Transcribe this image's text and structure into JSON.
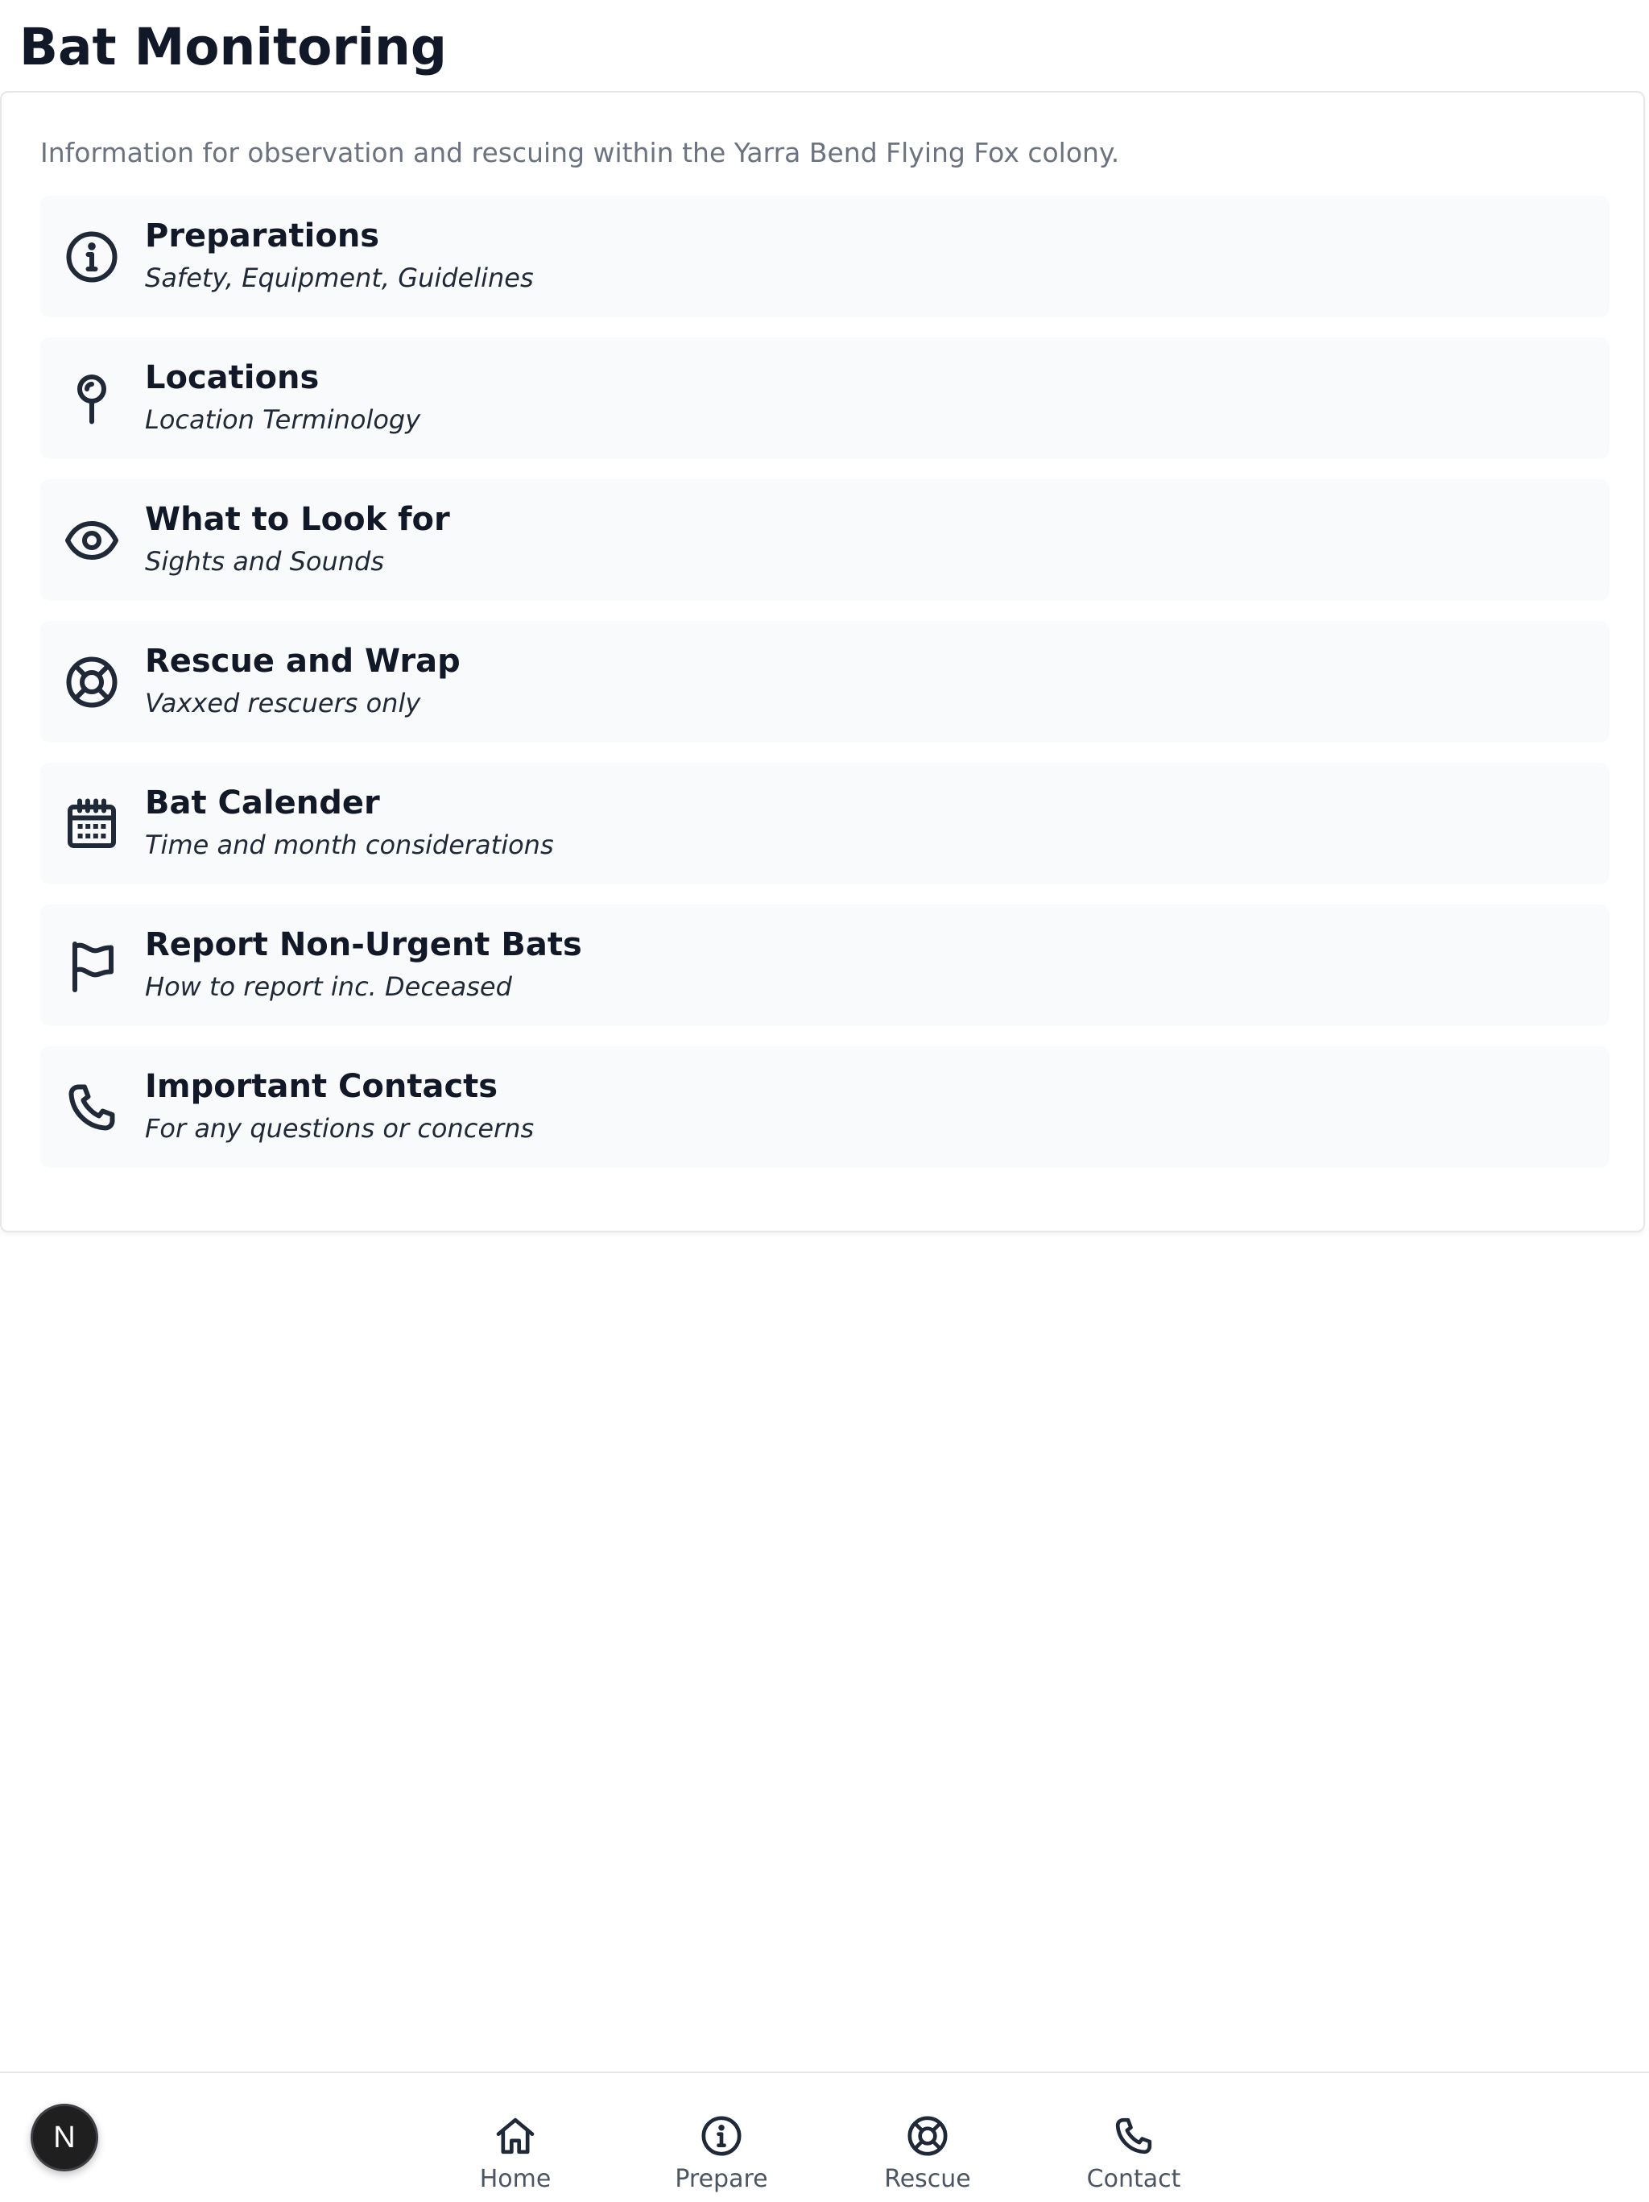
{
  "header": {
    "title": "Bat Monitoring"
  },
  "card": {
    "intro": "Information for observation and rescuing within the Yarra Bend Flying Fox colony.",
    "items": [
      {
        "title": "Preparations",
        "subtitle": "Safety, Equipment, Guidelines",
        "icon": "info-circle-icon"
      },
      {
        "title": "Locations",
        "subtitle": "Location Terminology",
        "icon": "map-pin-icon"
      },
      {
        "title": "What to Look for",
        "subtitle": "Sights and Sounds",
        "icon": "eye-icon"
      },
      {
        "title": "Rescue and Wrap",
        "subtitle": "Vaxxed rescuers only",
        "icon": "lifebuoy-icon"
      },
      {
        "title": "Bat Calender",
        "subtitle": "Time and month considerations",
        "icon": "calendar-icon"
      },
      {
        "title": "Report Non-Urgent Bats",
        "subtitle": "How to report inc. Deceased",
        "icon": "flag-icon"
      },
      {
        "title": "Important Contacts",
        "subtitle": "For any questions or concerns",
        "icon": "phone-icon"
      }
    ]
  },
  "bottom_nav": {
    "items": [
      {
        "label": "Home",
        "icon": "home-icon"
      },
      {
        "label": "Prepare",
        "icon": "info-circle-icon"
      },
      {
        "label": "Rescue",
        "icon": "lifebuoy-icon"
      },
      {
        "label": "Contact",
        "icon": "phone-icon"
      }
    ]
  },
  "avatar": {
    "letter": "N"
  },
  "colors": {
    "text_primary": "#111827",
    "text_muted": "#6b7280",
    "item_background": "#f9fafb",
    "border": "#e5e7eb"
  }
}
